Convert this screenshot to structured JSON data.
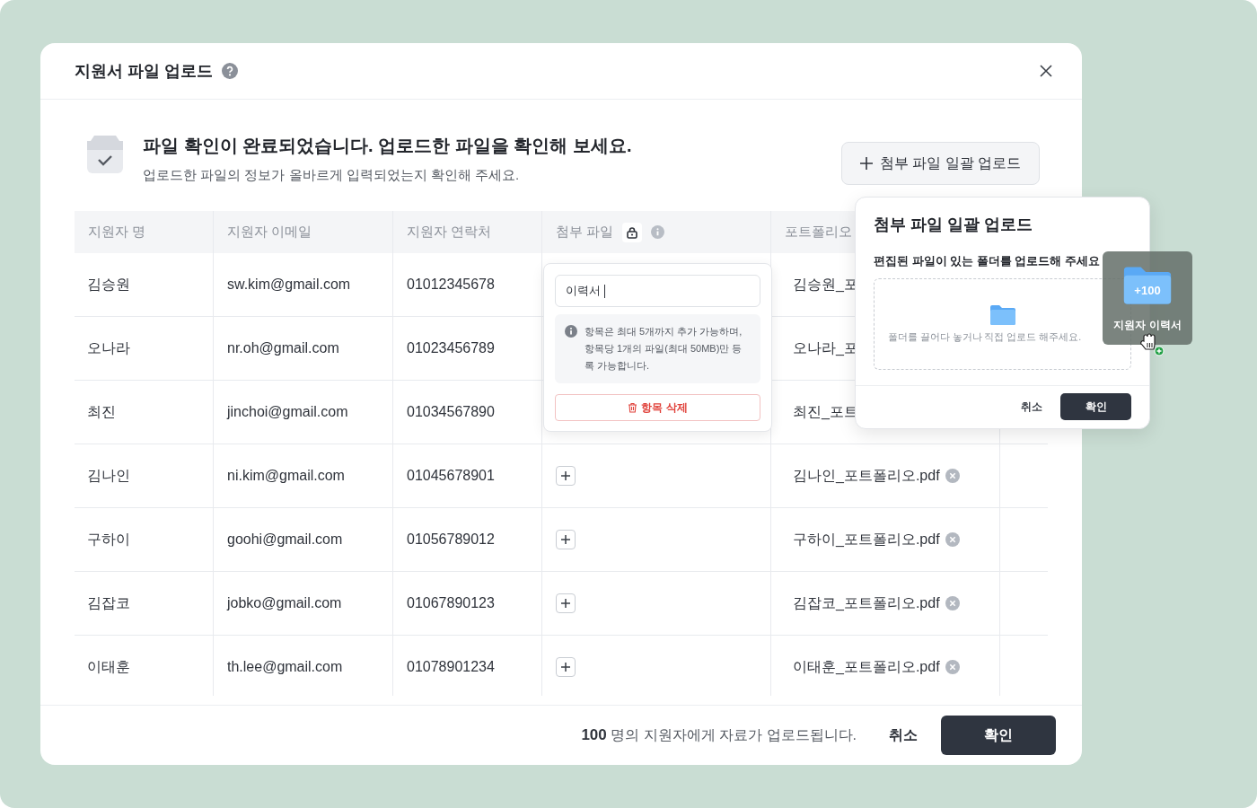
{
  "dialog": {
    "title": "지원서 파일 업로드"
  },
  "notice": {
    "title": "파일 확인이 완료되었습니다. 업로드한 파일을 확인해 보세요.",
    "description": "업로드한 파일의 정보가 올바르게 입력되었는지 확인해 주세요."
  },
  "bulk_upload_button": "첨부 파일 일괄 업로드",
  "table": {
    "columns": [
      {
        "label": "지원자 명",
        "kind": "text"
      },
      {
        "label": "지원자 이메일",
        "kind": "text"
      },
      {
        "label": "지원자 연락처",
        "kind": "text"
      },
      {
        "label": "첨부 파일",
        "kind": "attachment"
      },
      {
        "label": "포트폴리오",
        "kind": "text"
      }
    ],
    "rows": [
      {
        "kind": "covered",
        "name": "김승원",
        "email": "sw.kim@gmail.com",
        "phone": "01012345678",
        "portfolio": "김승원_포"
      },
      {
        "kind": "covered",
        "name": "오나라",
        "email": "nr.oh@gmail.com",
        "phone": "01023456789",
        "portfolio": "오나라_포"
      },
      {
        "kind": "covered",
        "name": "최진",
        "email": "jinchoi@gmail.com",
        "phone": "01034567890",
        "portfolio": "최진_포트"
      },
      {
        "kind": "file",
        "name": "김나인",
        "email": "ni.kim@gmail.com",
        "phone": "01045678901",
        "portfolio": "김나인_포트폴리오.pdf"
      },
      {
        "kind": "file",
        "name": "구하이",
        "email": "goohi@gmail.com",
        "phone": "01056789012",
        "portfolio": "구하이_포트폴리오.pdf"
      },
      {
        "kind": "file",
        "name": "김잡코",
        "email": "jobko@gmail.com",
        "phone": "01067890123",
        "portfolio": "김잡코_포트폴리오.pdf"
      },
      {
        "kind": "file",
        "name": "이태훈",
        "email": "th.lee@gmail.com",
        "phone": "01078901234",
        "portfolio": "이태훈_포트폴리오.pdf"
      }
    ]
  },
  "attachment_popover": {
    "input_value": "이력서",
    "notice": "항목은 최대 5개까지 추가 가능하며, 항목당 1개의 파일(최대 50MB)만 등록 가능합니다.",
    "delete_button": "항목 삭제"
  },
  "bulk_popover": {
    "title": "첨부 파일 일괄 업로드",
    "subtitle": "편집된 파일이 있는 폴더를 업로드해 주세요",
    "dropzone_text": "폴더를 끌어다 놓거나 직접 업로드 해주세요.",
    "cancel": "취소",
    "confirm": "확인"
  },
  "drag_ghost": {
    "badge": "+100",
    "label": "지원자 이력서"
  },
  "footer": {
    "summary": "**100** 명의 지원자에게 자료가 업로드됩니다.",
    "cancel": "취소",
    "confirm": "확인"
  }
}
